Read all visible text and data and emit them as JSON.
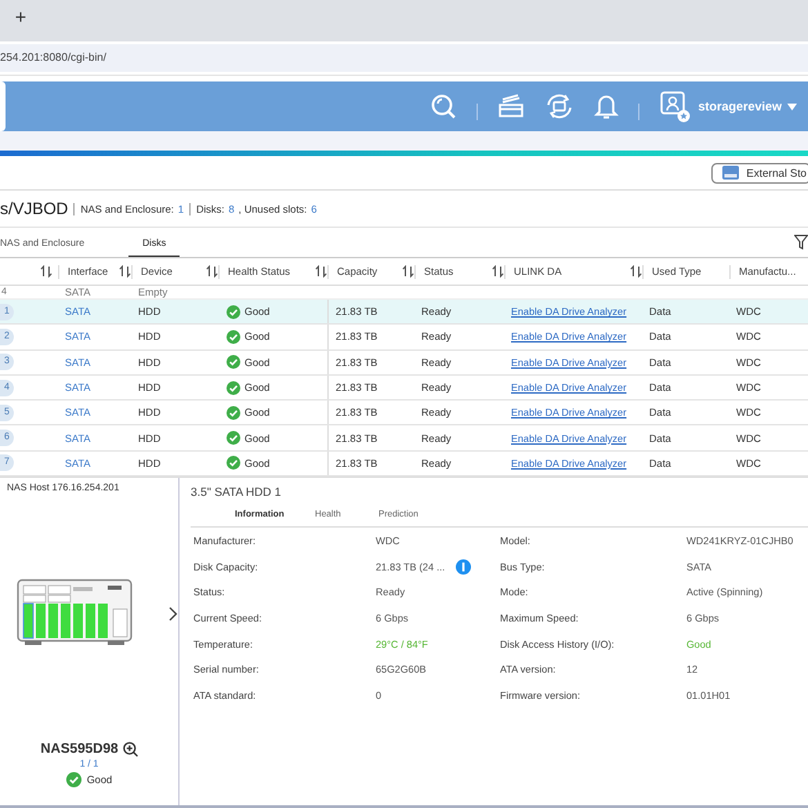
{
  "browser": {
    "new_tab": "+",
    "address": "254.201:8080/cgi-bin/"
  },
  "header": {
    "user": "storagereview"
  },
  "toolbar": {
    "external_button": "External Sto"
  },
  "summary": {
    "title": "s/VJBOD",
    "parts": [
      {
        "label": "NAS and Enclosure:",
        "value": "1"
      },
      {
        "label": "Disks:",
        "value": "8"
      },
      {
        "label": ", Unused slots:",
        "value": "6"
      }
    ]
  },
  "tabs": [
    {
      "label": "NAS and Enclosure",
      "selected": false
    },
    {
      "label": "Disks",
      "selected": true
    }
  ],
  "table": {
    "columns": [
      {
        "sortable": true
      },
      {
        "label": "Interface",
        "sortable": true
      },
      {
        "label": "Device",
        "sortable": true
      },
      {
        "label": "Health Status",
        "sortable": true
      },
      {
        "label": "Capacity",
        "sortable": true
      },
      {
        "label": "Status",
        "sortable": true
      },
      {
        "label": "ULINK DA",
        "sortable": true
      },
      {
        "label": "Used Type",
        "sortable": false
      },
      {
        "label": "Manufactu...",
        "sortable": false
      }
    ],
    "partial_row": {
      "index": "4",
      "interface": "SATA",
      "device": "Empty"
    },
    "rows": [
      {
        "index": "1",
        "interface": "SATA",
        "device": "HDD",
        "health": "Good",
        "capacity": "21.83 TB",
        "status": "Ready",
        "ulink": "Enable DA Drive Analyzer",
        "used_type": "Data",
        "manufacturer": "WDC",
        "selected": true
      },
      {
        "index": "2",
        "interface": "SATA",
        "device": "HDD",
        "health": "Good",
        "capacity": "21.83 TB",
        "status": "Ready",
        "ulink": "Enable DA Drive Analyzer",
        "used_type": "Data",
        "manufacturer": "WDC",
        "selected": false
      },
      {
        "index": "3",
        "interface": "SATA",
        "device": "HDD",
        "health": "Good",
        "capacity": "21.83 TB",
        "status": "Ready",
        "ulink": "Enable DA Drive Analyzer",
        "used_type": "Data",
        "manufacturer": "WDC",
        "selected": false
      },
      {
        "index": "4",
        "interface": "SATA",
        "device": "HDD",
        "health": "Good",
        "capacity": "21.83 TB",
        "status": "Ready",
        "ulink": "Enable DA Drive Analyzer",
        "used_type": "Data",
        "manufacturer": "WDC",
        "selected": false
      },
      {
        "index": "5",
        "interface": "SATA",
        "device": "HDD",
        "health": "Good",
        "capacity": "21.83 TB",
        "status": "Ready",
        "ulink": "Enable DA Drive Analyzer",
        "used_type": "Data",
        "manufacturer": "WDC",
        "selected": false
      },
      {
        "index": "6",
        "interface": "SATA",
        "device": "HDD",
        "health": "Good",
        "capacity": "21.83 TB",
        "status": "Ready",
        "ulink": "Enable DA Drive Analyzer",
        "used_type": "Data",
        "manufacturer": "WDC",
        "selected": false
      },
      {
        "index": "7",
        "interface": "SATA",
        "device": "HDD",
        "health": "Good",
        "capacity": "21.83 TB",
        "status": "Ready",
        "ulink": "Enable DA Drive Analyzer",
        "used_type": "Data",
        "manufacturer": "WDC",
        "selected": false
      }
    ]
  },
  "host": {
    "label": "NAS Host 176.16.254.201",
    "name": "NAS595D98",
    "count": "1 / 1",
    "health": "Good"
  },
  "detail": {
    "title": "3.5\" SATA HDD 1",
    "tabs": [
      {
        "label": "Information",
        "selected": true
      },
      {
        "label": "Health",
        "selected": false
      },
      {
        "label": "Prediction",
        "selected": false
      }
    ],
    "rows": [
      [
        {
          "label": "Manufacturer:",
          "value": "WDC",
          "highlight": false,
          "info": false
        },
        {
          "label": "Model:",
          "value": "WD241KRYZ-01CJHB0",
          "highlight": false,
          "info": false
        }
      ],
      [
        {
          "label": "Disk Capacity:",
          "value": "21.83 TB (24 ...",
          "highlight": false,
          "info": true
        },
        {
          "label": "Bus Type:",
          "value": "SATA",
          "highlight": false,
          "info": false
        }
      ],
      [
        {
          "label": "Status:",
          "value": "Ready",
          "highlight": false,
          "info": false
        },
        {
          "label": "Mode:",
          "value": "Active (Spinning)",
          "highlight": false,
          "info": false
        }
      ],
      [
        {
          "label": "Current Speed:",
          "value": "6 Gbps",
          "highlight": false,
          "info": false
        },
        {
          "label": "Maximum Speed:",
          "value": "6 Gbps",
          "highlight": false,
          "info": false
        }
      ],
      [
        {
          "label": "Temperature:",
          "value": "29°C / 84°F",
          "highlight": true,
          "info": false
        },
        {
          "label": "Disk Access History (I/O):",
          "value": "Good",
          "highlight": true,
          "info": false
        }
      ],
      [
        {
          "label": "Serial number:",
          "value": "65G2G60B",
          "highlight": false,
          "info": false
        },
        {
          "label": "ATA version:",
          "value": "12",
          "highlight": false,
          "info": false
        }
      ],
      [
        {
          "label": "ATA standard:",
          "value": "0",
          "highlight": false,
          "info": false
        },
        {
          "label": "Firmware version:",
          "value": "01.01H01",
          "highlight": false,
          "info": false
        }
      ]
    ]
  }
}
